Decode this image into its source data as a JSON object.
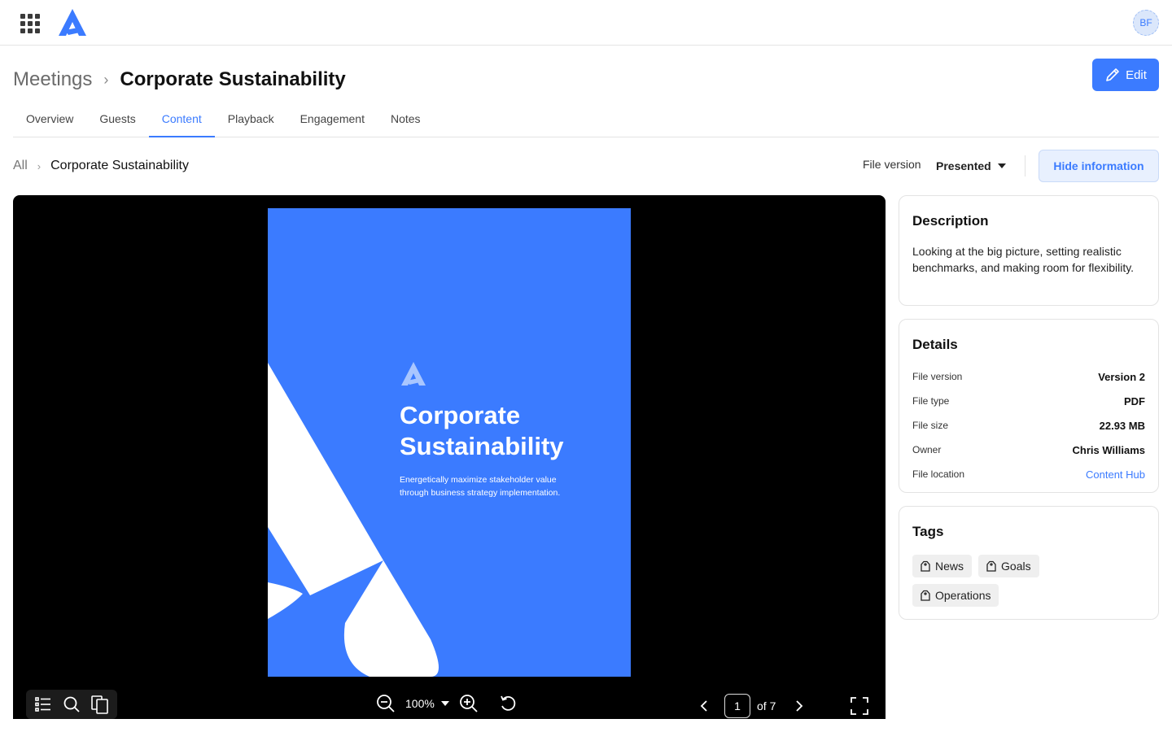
{
  "user": {
    "initials": "BF"
  },
  "header": {
    "parent": "Meetings",
    "separator": "›",
    "title": "Corporate Sustainability",
    "edit_label": "Edit"
  },
  "tabs": [
    {
      "label": "Overview"
    },
    {
      "label": "Guests"
    },
    {
      "label": "Content",
      "active": true
    },
    {
      "label": "Playback"
    },
    {
      "label": "Engagement"
    },
    {
      "label": "Notes"
    }
  ],
  "content_bar": {
    "parent": "All",
    "separator": "›",
    "title": "Corporate Sustainability",
    "file_version_label": "File version",
    "file_version_value": "Presented",
    "hide_info_label": "Hide information"
  },
  "document": {
    "title_line1": "Corporate",
    "title_line2": "Sustainability",
    "subtitle_line1": "Energetically maximize stakeholder value",
    "subtitle_line2": "through business strategy implementation.",
    "background_color": "#3b7bff"
  },
  "viewer_toolbar": {
    "zoom": "100%",
    "current_page": "1",
    "total_pages_label": "of 7",
    "icons": [
      "outline-icon",
      "search-icon",
      "thumbnails-icon",
      "zoom-out-icon",
      "zoom-in-icon",
      "rotate-icon",
      "chevron-left-icon",
      "chevron-right-icon",
      "fullscreen-icon"
    ]
  },
  "description": {
    "heading": "Description",
    "text": "Looking at the big picture, setting realistic benchmarks, and making room for flexibility."
  },
  "details": {
    "heading": "Details",
    "rows": [
      {
        "label": "File version",
        "value": "Version 2"
      },
      {
        "label": "File type",
        "value": "PDF"
      },
      {
        "label": "File size",
        "value": "22.93 MB"
      },
      {
        "label": "Owner",
        "value": "Chris Williams"
      },
      {
        "label": "File location",
        "value": "Content Hub"
      }
    ]
  },
  "tags": {
    "heading": "Tags",
    "items": [
      "News",
      "Goals",
      "Operations"
    ]
  },
  "colors": {
    "accent": "#3b7bff",
    "viewer_bg": "#000000"
  }
}
